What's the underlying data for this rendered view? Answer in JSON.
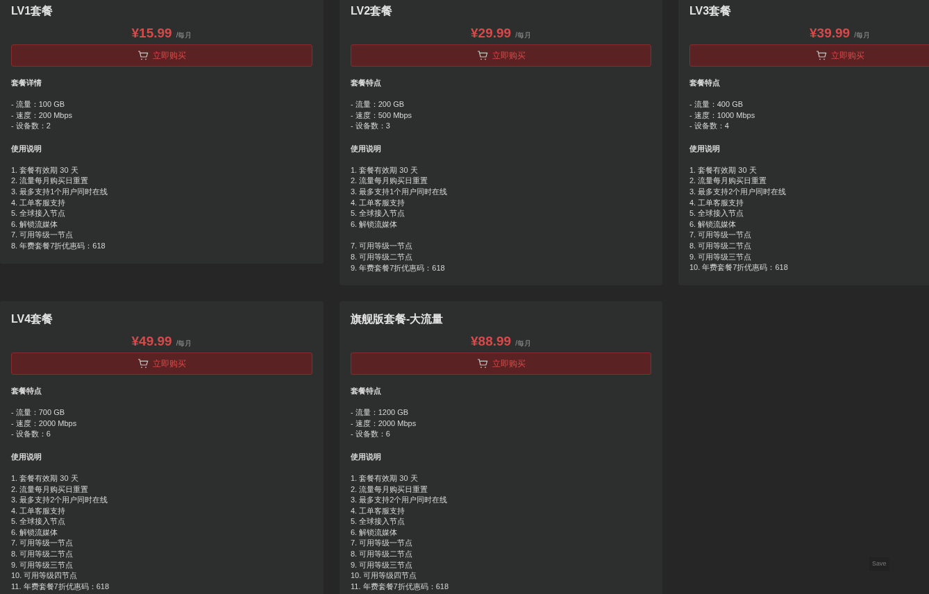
{
  "plans": [
    {
      "title": "LV1套餐",
      "price": "¥15.99",
      "period": "/每月",
      "buy_button": "立即购买",
      "blocks": [
        {
          "kind": "heading",
          "lines": [
            "套餐详情"
          ]
        },
        {
          "kind": "list",
          "lines": [
            "- 流量：100 GB",
            "- 速度：200 Mbps",
            "- 设备数：2"
          ]
        },
        {
          "kind": "heading",
          "lines": [
            "使用说明"
          ]
        },
        {
          "kind": "list",
          "lines": [
            "1. 套餐有效期 30 天",
            "2. 流量每月购买日重置",
            "3. 最多支持1个用户同时在线",
            "4. 工单客服支持",
            "5. 全球接入节点",
            "6. 解锁流媒体",
            "7. 可用等级一节点",
            "8. 年费套餐7折优惠码：618"
          ]
        }
      ]
    },
    {
      "title": "LV2套餐",
      "price": "¥29.99",
      "period": "/每月",
      "buy_button": "立即购买",
      "blocks": [
        {
          "kind": "heading",
          "lines": [
            "套餐特点"
          ]
        },
        {
          "kind": "list",
          "lines": [
            "- 流量：200 GB",
            "- 速度：500 Mbps",
            "- 设备数：3"
          ]
        },
        {
          "kind": "heading",
          "lines": [
            "使用说明"
          ]
        },
        {
          "kind": "list",
          "lines": [
            "1. 套餐有效期 30 天",
            "2. 流量每月购买日重置",
            "3. 最多支持1个用户同时在线",
            "4. 工单客服支持",
            "5. 全球接入节点",
            "6. 解锁流媒体"
          ]
        },
        {
          "kind": "list",
          "lines": [
            "7. 可用等级一节点",
            "8. 可用等级二节点",
            "9. 年费套餐7折优惠码：618"
          ]
        }
      ]
    },
    {
      "title": "LV3套餐",
      "price": "¥39.99",
      "period": "/每月",
      "buy_button": "立即购买",
      "blocks": [
        {
          "kind": "heading",
          "lines": [
            "套餐特点"
          ]
        },
        {
          "kind": "list",
          "lines": [
            "- 流量：400 GB",
            "- 速度：1000 Mbps",
            "- 设备数：4"
          ]
        },
        {
          "kind": "heading",
          "lines": [
            "使用说明"
          ]
        },
        {
          "kind": "list",
          "lines": [
            "1. 套餐有效期 30 天",
            "2. 流量每月购买日重置",
            "3. 最多支持2个用户同时在线",
            "4. 工单客服支持",
            "5. 全球接入节点",
            "6. 解锁流媒体",
            "7. 可用等级一节点",
            "8. 可用等级二节点",
            "9. 可用等级三节点",
            "10. 年费套餐7折优惠码：618"
          ]
        }
      ]
    },
    {
      "title": "LV4套餐",
      "price": "¥49.99",
      "period": "/每月",
      "buy_button": "立即购买",
      "blocks": [
        {
          "kind": "heading",
          "lines": [
            "套餐特点"
          ]
        },
        {
          "kind": "list",
          "lines": [
            "- 流量：700 GB",
            "- 速度：2000 Mbps",
            "- 设备数：6"
          ]
        },
        {
          "kind": "heading",
          "lines": [
            "使用说明"
          ]
        },
        {
          "kind": "list",
          "lines": [
            "1. 套餐有效期 30 天",
            "2. 流量每月购买日重置",
            "3. 最多支持2个用户同时在线",
            "4. 工单客服支持",
            "5. 全球接入节点",
            "6. 解锁流媒体",
            "7. 可用等级一节点",
            "8. 可用等级二节点",
            "9. 可用等级三节点",
            "10. 可用等级四节点",
            "11. 年费套餐7折优惠码：618"
          ]
        }
      ]
    },
    {
      "title": "旗舰版套餐-大流量",
      "price": "¥88.99",
      "period": "/每月",
      "buy_button": "立即购买",
      "blocks": [
        {
          "kind": "heading",
          "lines": [
            "套餐特点"
          ]
        },
        {
          "kind": "list",
          "lines": [
            "- 流量：1200 GB",
            "- 速度：2000 Mbps",
            "- 设备数：6"
          ]
        },
        {
          "kind": "heading",
          "lines": [
            "使用说明"
          ]
        },
        {
          "kind": "list",
          "lines": [
            "1. 套餐有效期 30 天",
            "2. 流量每月购买日重置",
            "3. 最多支持2个用户同时在线",
            "4. 工单客服支持",
            "5. 全球接入节点",
            "6. 解锁流媒体",
            "7. 可用等级一节点",
            "8. 可用等级二节点",
            "9. 可用等级三节点",
            "10. 可用等级四节点",
            "11. 年费套餐7折优惠码：618"
          ]
        }
      ]
    }
  ],
  "save_button": "Save"
}
